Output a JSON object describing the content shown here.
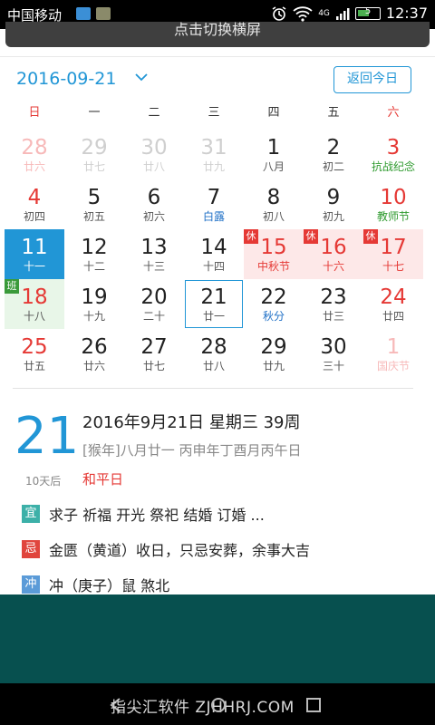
{
  "status_bar": {
    "carrier": "中国移动",
    "time": "12:37",
    "network": "4G",
    "battery": "5"
  },
  "banner": {
    "text": "点击切换横屏"
  },
  "header": {
    "date": "2016-09-21",
    "today_button": "返回今日"
  },
  "weekdays": [
    "日",
    "一",
    "二",
    "三",
    "四",
    "五",
    "六"
  ],
  "calendar": {
    "days": [
      {
        "num": "28",
        "lunar": "廿六",
        "type": "other red"
      },
      {
        "num": "29",
        "lunar": "廿七",
        "type": "other"
      },
      {
        "num": "30",
        "lunar": "廿八",
        "type": "other"
      },
      {
        "num": "31",
        "lunar": "廿九",
        "type": "other"
      },
      {
        "num": "1",
        "lunar": "八月",
        "type": ""
      },
      {
        "num": "2",
        "lunar": "初二",
        "type": ""
      },
      {
        "num": "3",
        "lunar": "抗战纪念",
        "type": "red green"
      },
      {
        "num": "4",
        "lunar": "初四",
        "type": "red"
      },
      {
        "num": "5",
        "lunar": "初五",
        "type": ""
      },
      {
        "num": "6",
        "lunar": "初六",
        "type": ""
      },
      {
        "num": "7",
        "lunar": "白露",
        "type": "blue"
      },
      {
        "num": "8",
        "lunar": "初八",
        "type": ""
      },
      {
        "num": "9",
        "lunar": "初九",
        "type": ""
      },
      {
        "num": "10",
        "lunar": "教师节",
        "type": "red green"
      },
      {
        "num": "11",
        "lunar": "十一",
        "type": "sel"
      },
      {
        "num": "12",
        "lunar": "十二",
        "type": ""
      },
      {
        "num": "13",
        "lunar": "十三",
        "type": ""
      },
      {
        "num": "14",
        "lunar": "十四",
        "type": ""
      },
      {
        "num": "15",
        "lunar": "中秋节",
        "type": "holiday",
        "tag": "休"
      },
      {
        "num": "16",
        "lunar": "十六",
        "type": "holiday",
        "tag": "休"
      },
      {
        "num": "17",
        "lunar": "十七",
        "type": "holiday",
        "tag": "休"
      },
      {
        "num": "18",
        "lunar": "十八",
        "type": "workday red",
        "tag": "班"
      },
      {
        "num": "19",
        "lunar": "十九",
        "type": ""
      },
      {
        "num": "20",
        "lunar": "二十",
        "type": ""
      },
      {
        "num": "21",
        "lunar": "廿一",
        "type": "today"
      },
      {
        "num": "22",
        "lunar": "秋分",
        "type": "blue"
      },
      {
        "num": "23",
        "lunar": "廿三",
        "type": ""
      },
      {
        "num": "24",
        "lunar": "廿四",
        "type": "red"
      },
      {
        "num": "25",
        "lunar": "廿五",
        "type": "red"
      },
      {
        "num": "26",
        "lunar": "廿六",
        "type": ""
      },
      {
        "num": "27",
        "lunar": "廿七",
        "type": ""
      },
      {
        "num": "28",
        "lunar": "廿八",
        "type": ""
      },
      {
        "num": "29",
        "lunar": "廿九",
        "type": ""
      },
      {
        "num": "30",
        "lunar": "三十",
        "type": ""
      },
      {
        "num": "1",
        "lunar": "国庆节",
        "type": "other red"
      }
    ]
  },
  "detail": {
    "day": "21",
    "days_after": "10天后",
    "solar": "2016年9月21日 星期三 39周",
    "lunar": "[猴年]八月廿一 丙申年丁酉月丙午日",
    "festival": "和平日",
    "yi_label": "宜",
    "yi_text": "求子  祈福  开光  祭祀  结婚  订婚  ...",
    "ji_label": "忌",
    "ji_text": "金匮（黄道）收日，只忌安葬，余事大吉",
    "chong_label": "冲",
    "chong_text": "冲（庚子）鼠  煞北"
  },
  "navbar": {
    "watermark": "指尖汇软件 ZJHHRJ.COM"
  },
  "colors": {
    "accent": "#2196d6",
    "red": "#e53935",
    "teal": "#07504f"
  }
}
